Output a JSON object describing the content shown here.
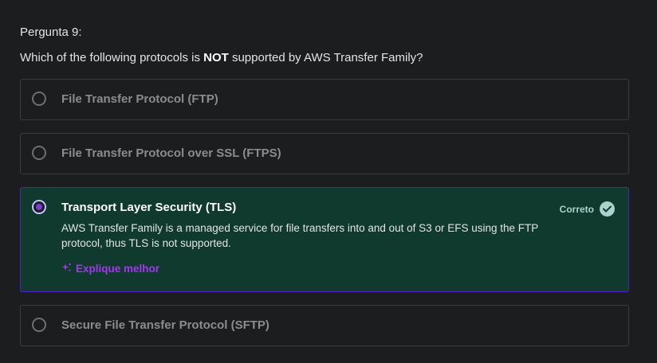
{
  "question": {
    "label": "Pergunta 9:",
    "text_before": "Which of the following protocols is ",
    "text_emphasis": "NOT",
    "text_after": " supported by AWS Transfer Family?"
  },
  "options": [
    {
      "label": "File Transfer Protocol (FTP)",
      "selected": false
    },
    {
      "label": "File Transfer Protocol over SSL (FTPS)",
      "selected": false
    },
    {
      "label": "Transport Layer Security (TLS)",
      "selected": true,
      "status": "Correto",
      "explanation": "AWS Transfer Family is a managed service for file transfers into and out of S3 or EFS using the FTP protocol, thus TLS is not supported.",
      "explain_button": "Explique melhor"
    },
    {
      "label": "Secure File Transfer Protocol (SFTP)",
      "selected": false
    }
  ],
  "colors": {
    "background": "#1c1d1f",
    "correct_bg": "#0f3a2d",
    "selected_border": "#5022c3",
    "accent_purple": "#a435f0",
    "correct_green": "#acd2cc"
  },
  "icons": {
    "radio": "radio-button-icon",
    "check": "check-circle-icon",
    "sparkle": "sparkle-icon"
  }
}
